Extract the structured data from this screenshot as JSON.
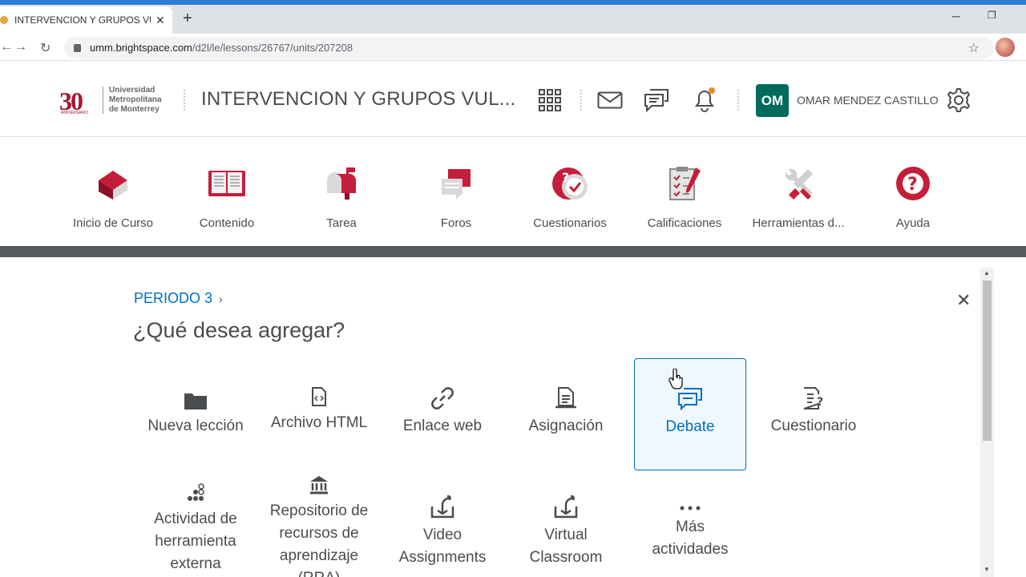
{
  "browser": {
    "tab_title": "INTERVENCION Y GRUPOS VULN",
    "tab_close": "✕",
    "new_tab": "+",
    "url_host": "umm.brightspace.com",
    "url_path": "/d2l/le/lessons/26767/units/207208",
    "minimize": "─",
    "restore": "❐"
  },
  "header": {
    "logo_number": "30",
    "logo_sub": "ANIVERSARIO",
    "logo_line1": "Universidad",
    "logo_line2": "Metropolitana",
    "logo_line3": "de Monterrey",
    "course_title": "INTERVENCION Y GRUPOS VUL...",
    "user_initials": "OM",
    "user_name": "OMAR MENDEZ CASTILLO"
  },
  "course_nav": [
    {
      "label": "Inicio de Curso"
    },
    {
      "label": "Contenido"
    },
    {
      "label": "Tarea"
    },
    {
      "label": "Foros"
    },
    {
      "label": "Cuestionarios"
    },
    {
      "label": "Calificaciones"
    },
    {
      "label": "Herramientas d..."
    },
    {
      "label": "Ayuda"
    }
  ],
  "dialog": {
    "breadcrumb": "PERIODO 3",
    "breadcrumb_chevron": "›",
    "title": "¿Qué desea agregar?",
    "close": "✕",
    "tiles": [
      {
        "line1": "Nueva lección",
        "line2": ""
      },
      {
        "line1": "Archivo HTML",
        "line2": ""
      },
      {
        "line1": "Enlace web",
        "line2": ""
      },
      {
        "line1": "Asignación",
        "line2": ""
      },
      {
        "line1": "Debate",
        "line2": ""
      },
      {
        "line1": "Cuestionario",
        "line2": ""
      },
      {
        "line1": "Actividad de",
        "line2": "herramienta",
        "line3": "externa"
      },
      {
        "line1": "Repositorio de",
        "line2": "recursos de",
        "line3": "aprendizaje",
        "line4": "(RRA)"
      },
      {
        "line1": "Video",
        "line2": "Assignments"
      },
      {
        "line1": "Virtual",
        "line2": "Classroom"
      },
      {
        "line1": "Más",
        "line2": "actividades"
      }
    ]
  },
  "colors": {
    "brand_red": "#a5162f",
    "link_blue": "#006fbf",
    "om_green": "#006b5a",
    "notification_dot": "#f08a24"
  }
}
